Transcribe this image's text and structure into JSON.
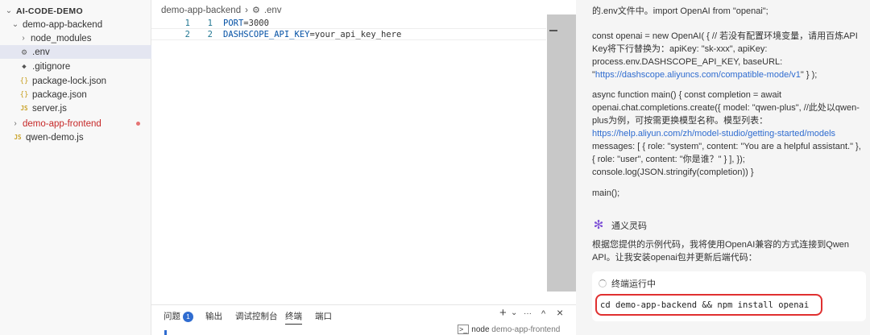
{
  "explorer": {
    "root": "AI-CODE-DEMO",
    "items": [
      {
        "label": "demo-app-backend",
        "chev": "⌄",
        "icon": "",
        "type": "folder-open"
      },
      {
        "label": "node_modules",
        "chev": "›",
        "icon": "",
        "type": "folder"
      },
      {
        "label": ".env",
        "chev": "",
        "icon": "⚙",
        "type": "file-env"
      },
      {
        "label": ".gitignore",
        "chev": "",
        "icon": "◆",
        "type": "file-git"
      },
      {
        "label": "package-lock.json",
        "chev": "",
        "icon": "{}",
        "type": "file-json"
      },
      {
        "label": "package.json",
        "chev": "",
        "icon": "{}",
        "type": "file-json"
      },
      {
        "label": "server.js",
        "chev": "",
        "icon": "JS",
        "type": "file-js"
      },
      {
        "label": "demo-app-frontend",
        "chev": "›",
        "icon": "",
        "type": "folder-modified"
      },
      {
        "label": "qwen-demo.js",
        "chev": "",
        "icon": "JS",
        "type": "file-js"
      }
    ]
  },
  "editor": {
    "breadcrumb": {
      "folder": "demo-app-backend",
      "sep": "›",
      "file": ".env"
    },
    "lines": [
      {
        "n1": "1",
        "n2": "1",
        "key": "PORT",
        "eq": "=",
        "value": "3000"
      },
      {
        "n1": "2",
        "n2": "2",
        "key": "DASHSCOPE_API_KEY",
        "eq": "=",
        "value": "your_api_key_here"
      }
    ]
  },
  "panel": {
    "tabs": [
      "问题",
      "输出",
      "调试控制台",
      "终端",
      "端口"
    ],
    "problems_count": "1",
    "active_tab": "终端",
    "icons": {
      "add": "+",
      "chevron": "⌄",
      "more": "···",
      "maximize": "^",
      "close": "×"
    },
    "terminal": {
      "shell": "node",
      "name": "demo-app-frontend"
    }
  },
  "chat": {
    "p1": "的.env文件中。import OpenAI from \"openai\";",
    "p2a": "const openai = new OpenAI( { // 若没有配置环境变量，请用百炼API Key将下行替换为：apiKey: \"sk-xxx\", apiKey: process.env.DASHSCOPE_API_KEY, baseURL: \"",
    "p2link": "https://dashscope.aliyuncs.com/compatible-mode/v1",
    "p2b": "\" } );",
    "p3a": "async function main() { const completion = await openai.chat.completions.create({ model: \"qwen-plus\", //此处以qwen-plus为例，可按需更换模型名称。模型列表：",
    "p3link": "https://help.aliyun.com/zh/model-studio/getting-started/models",
    "p3b": " messages: [ { role: \"system\", content: \"You are a helpful assistant.\" }, { role: \"user\", content: \"你是谁？\" } ], }); console.log(JSON.stringify(completion)) }",
    "p4": "main();",
    "agent_name": "通义灵码",
    "agent_msg": "根据您提供的示例代码，我将使用OpenAI兼容的方式连接到Qwen API。让我安装openai包并更新后端代码：",
    "terminal_status": "终端运行中",
    "command": "cd demo-app-backend && npm install openai"
  },
  "colors": {
    "accent": "#2f6cd0",
    "highlight_border": "#e03030",
    "modified": "#c62828"
  }
}
